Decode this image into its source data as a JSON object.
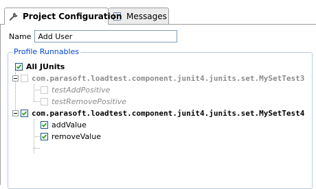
{
  "tabs": [
    {
      "label": "Project Configuration",
      "icon": "wrench-icon",
      "active": true
    },
    {
      "label": "Messages",
      "icon": "messages-icon",
      "active": false
    }
  ],
  "name_field": {
    "label": "Name",
    "value": "Add User"
  },
  "profile": {
    "title": "Profile Runnables",
    "all_junits": {
      "label": "All JUnits",
      "checked": true
    },
    "classes": [
      {
        "name": "com.parasoft.loadtest.component.junit4.junits.set.MySetTest3",
        "checked": false,
        "disabled": true,
        "expanded": true,
        "methods": [
          {
            "name": "testAddPositive",
            "checked": false,
            "disabled": true
          },
          {
            "name": "testRemovePositive",
            "checked": false,
            "disabled": true
          }
        ]
      },
      {
        "name": "com.parasoft.loadtest.component.junit4.junits.set.MySetTest4",
        "checked": true,
        "disabled": false,
        "expanded": true,
        "methods": [
          {
            "name": "addValue",
            "checked": true,
            "disabled": false
          },
          {
            "name": "removeValue",
            "checked": true,
            "disabled": false
          }
        ]
      }
    ]
  },
  "colors": {
    "group_title": "#0046d5",
    "checkmark": "#21a121",
    "disabled_text": "#8c8c8c"
  }
}
